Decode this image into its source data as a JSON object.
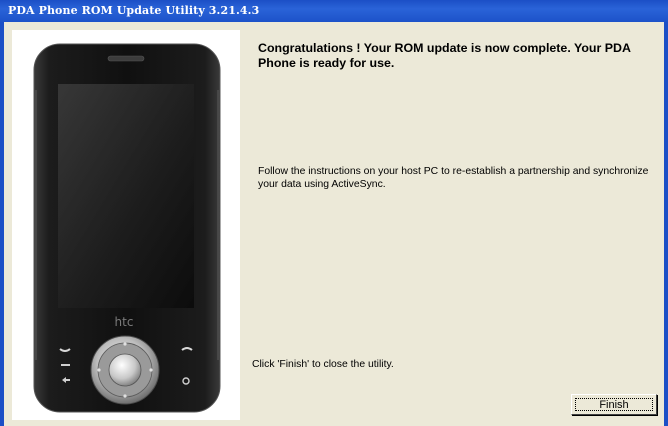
{
  "window": {
    "title": "PDA Phone ROM Update Utility 3.21.4.3"
  },
  "content": {
    "headline": "Congratulations ! Your ROM update is now complete. Your PDA Phone is ready for use.",
    "instructions": "Follow the instructions on your host PC to re-establish a partnership and synchronize your data using ActiveSync.",
    "close_hint": "Click 'Finish' to close the utility."
  },
  "phone": {
    "brand": "htc"
  },
  "buttons": {
    "finish": "Finish"
  },
  "colors": {
    "titlebar": "#1b4fc6",
    "background": "#ece9d8"
  }
}
